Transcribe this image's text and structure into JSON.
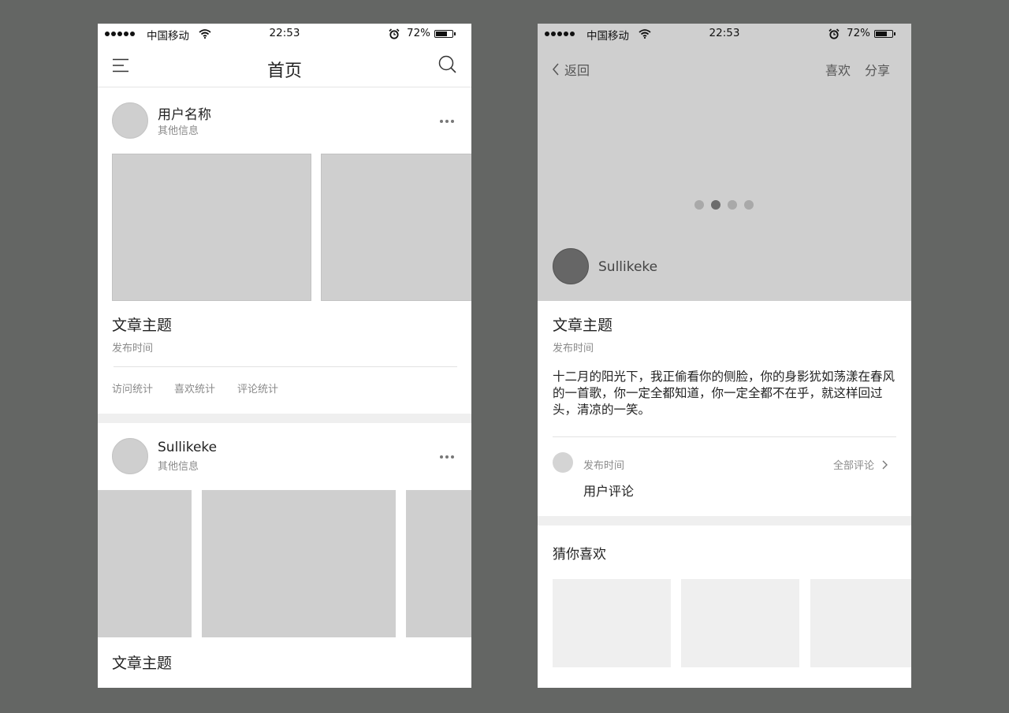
{
  "status_bar": {
    "carrier": "中国移动",
    "time": "22:53",
    "battery": "72%",
    "battery_level": 0.72
  },
  "home": {
    "title": "首页",
    "post1": {
      "user_name": "用户名称",
      "user_info": "其他信息",
      "topic": "文章主题",
      "publish_time": "发布时间",
      "stats": [
        "访问统计",
        "喜欢统计",
        "评论统计"
      ]
    },
    "post2": {
      "user_name": "Sullikeke",
      "user_info": "其他信息",
      "topic": "文章主题"
    }
  },
  "detail": {
    "back_label": "返回",
    "like_label": "喜欢",
    "share_label": "分享",
    "carousel_pages": 4,
    "carousel_active": 2,
    "author": "Sullikeke",
    "topic": "文章主题",
    "publish_time": "发布时间",
    "body": "十二月的阳光下，我正偷看你的侧脸，你的身影犹如荡漾在春风的一首歌，你一定全都知道，你一定全都不在乎，就这样回过头，清凉的一笑。",
    "comment": {
      "time": "发布时间",
      "all_comments": "全部评论",
      "text": "用户评论"
    },
    "guess_title": "猜你喜欢"
  }
}
